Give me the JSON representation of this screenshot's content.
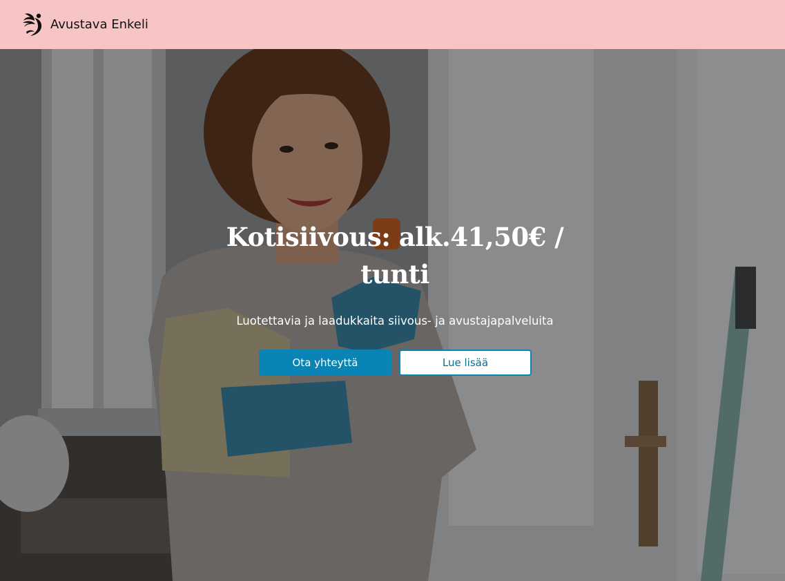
{
  "header": {
    "brand_name": "Avustava Enkeli",
    "logo_icon": "angel-wing-icon",
    "background_color": "#f8c5c5"
  },
  "hero": {
    "title": "Kotisiivous: alk.41,50€ / tunti",
    "subtitle": "Luotettavia ja laadukkaita siivous- ja avustajapalveluita",
    "primary_button_label": "Ota yhteyttä",
    "secondary_button_label": "Lue lisää",
    "accent_color": "#0a84b5"
  }
}
